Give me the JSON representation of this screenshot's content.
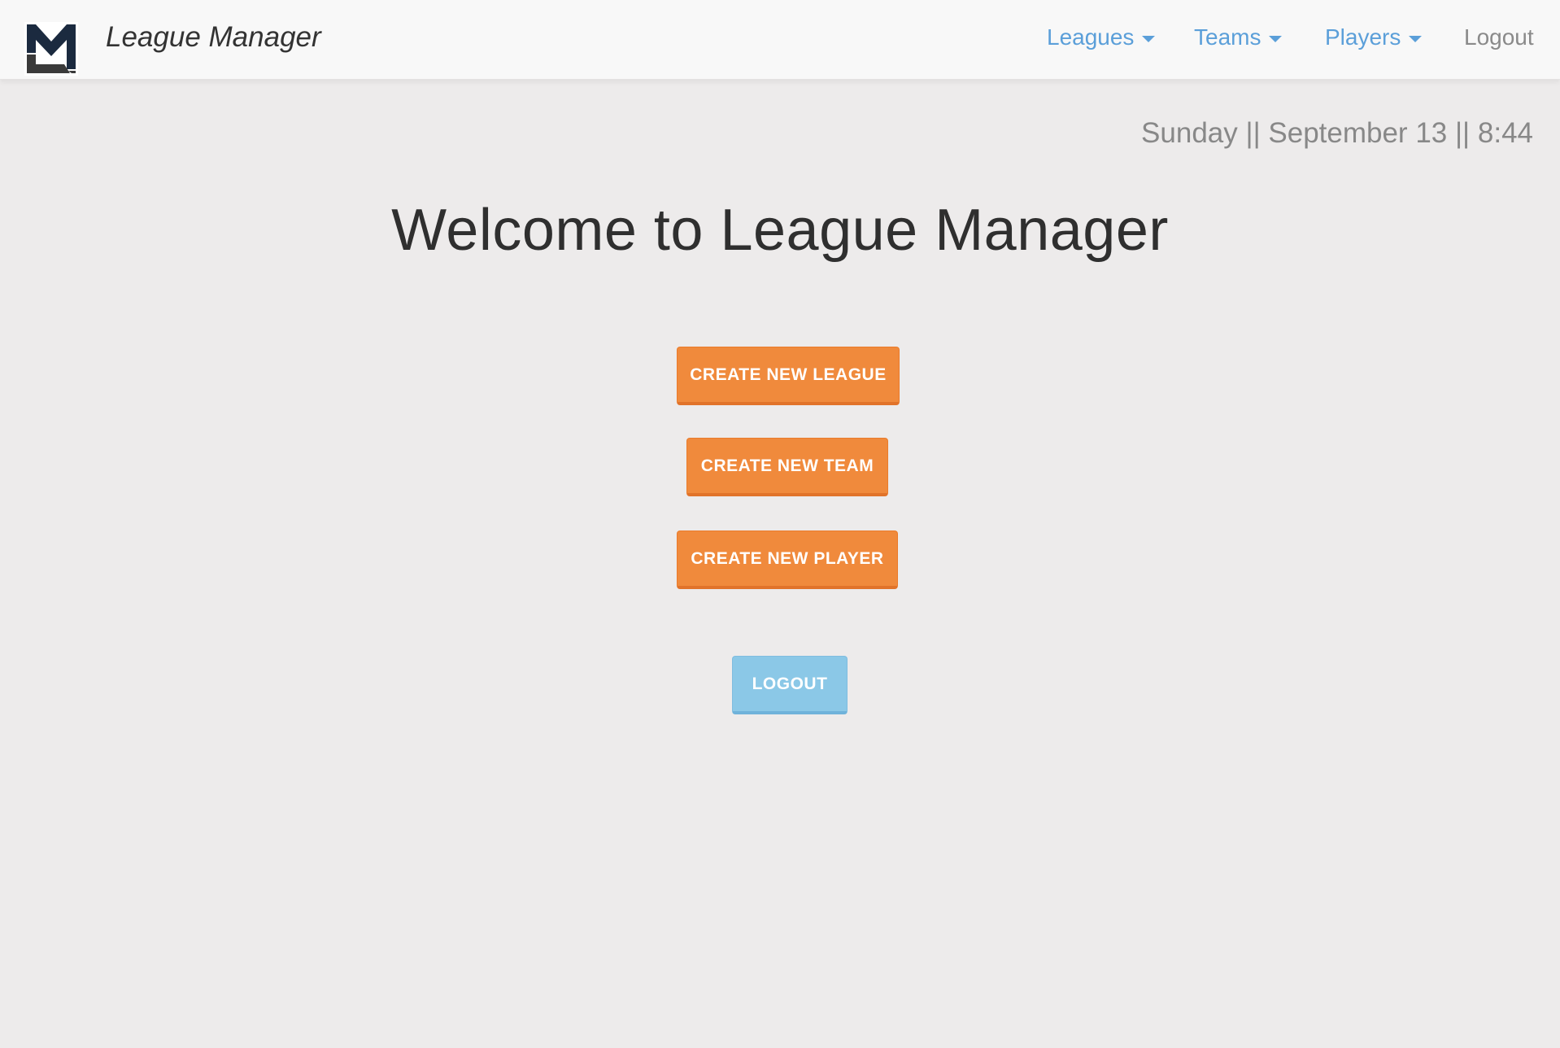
{
  "navbar": {
    "brand": "League Manager",
    "items": [
      {
        "label": "Leagues",
        "dropdown": true
      },
      {
        "label": "Teams",
        "dropdown": true
      },
      {
        "label": "Players",
        "dropdown": true
      },
      {
        "label": "Logout",
        "dropdown": false
      }
    ]
  },
  "datetime": "Sunday || September 13 || 8:44",
  "main": {
    "title": "Welcome to League Manager",
    "buttons": {
      "create_league": "CREATE NEW LEAGUE",
      "create_team": "CREATE NEW TEAM",
      "create_player": "CREATE NEW PLAYER",
      "logout": "LOGOUT"
    }
  },
  "colors": {
    "background": "#edebeb",
    "navbar_background": "#f8f8f8",
    "nav_link": "#5b9fd9",
    "primary_button": "#f08a3c",
    "logout_button": "#8bc8e7",
    "logo_dark": "#1b2a3f",
    "logo_gray": "#3a3a3a"
  },
  "icons": {
    "logo": "league-manager-logo-icon",
    "dropdown": "caret-down-icon"
  }
}
